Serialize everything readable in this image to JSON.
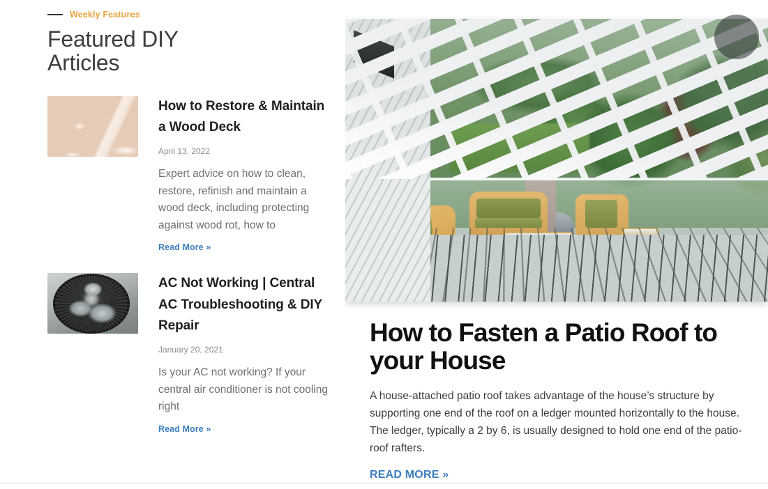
{
  "section": {
    "eyebrow": "Weekly Features",
    "title": "Featured DIY Articles",
    "dash_icon": "horizontal-dash-icon",
    "accent_color": "#e8a33d",
    "link_color": "#3d7ebd"
  },
  "articles": [
    {
      "thumb_alt": "water-droplets-on-wood-deck",
      "title": "How to Restore & Maintain a Wood Deck",
      "date": "April 13, 2022",
      "excerpt": "Expert advice on how to clean, restore, refinish and maintain a wood deck, including protecting against wood rot, how to",
      "read_more": "Read More »"
    },
    {
      "thumb_alt": "ac-condenser-fan-unit",
      "title": "AC Not Working | Central AC Troubleshooting & DIY Repair",
      "date": "January 20, 2021",
      "excerpt": "Is your AC not working? If your central air conditioner is not cooling right",
      "read_more": "Read More »"
    }
  ],
  "feature": {
    "hero_alt": "patio-roof-pergola-over-wood-deck-with-wicker-furniture",
    "badge_icon": "circular-overlay-badge-icon",
    "title": "How to Fasten a Patio Roof to your House",
    "description": "A house-attached patio roof takes advantage of the house’s structure by supporting one end of the roof on a ledger mounted horizontally to the house. The ledger, typically a 2 by 6, is usually designed to hold one end of the patio-roof rafters.",
    "read_more": "READ MORE »"
  }
}
